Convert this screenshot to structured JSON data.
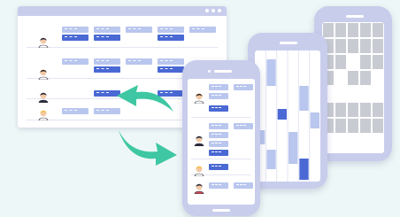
{
  "colors": {
    "background": "#eef7f7",
    "frame": "#c9cdec",
    "block_light": "#b9c6ee",
    "block_dark": "#4a69d4",
    "cell_gray": "#c9cbd3",
    "arrow": "#3ec7a2"
  },
  "icons": {
    "arrow_back": "curved-arrow-left-icon",
    "arrow_forward": "curved-arrow-right-icon",
    "avatar": "person-avatar-icon"
  },
  "desktop": {
    "rows": 5
  },
  "phone_front": {
    "rows": 5
  },
  "phone_middle": {
    "columns": 6
  },
  "phone_back": {
    "columns": 5
  }
}
